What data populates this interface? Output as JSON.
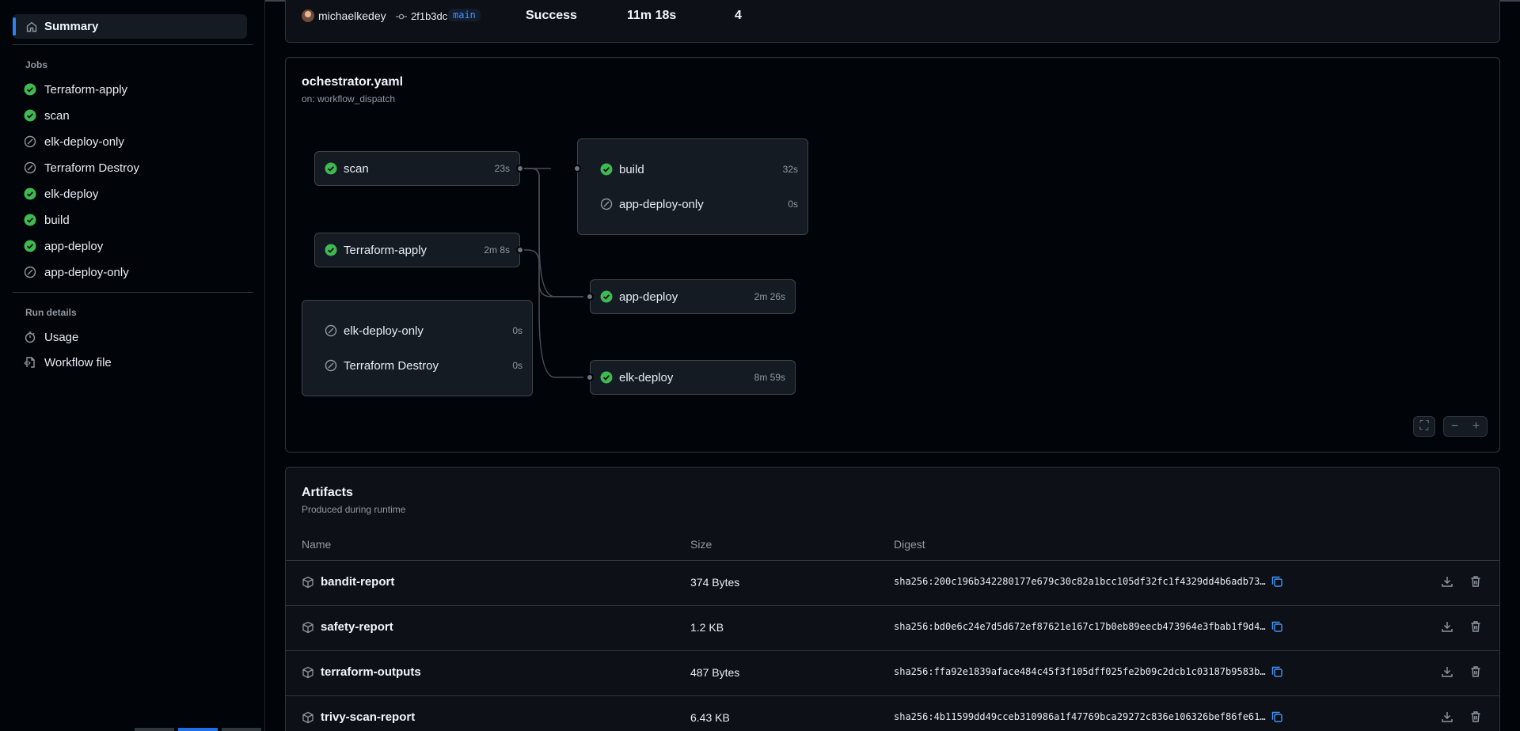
{
  "sidebar": {
    "summary_label": "Summary",
    "jobs_heading": "Jobs",
    "jobs": [
      {
        "label": "Terraform-apply",
        "status": "success"
      },
      {
        "label": "scan",
        "status": "success"
      },
      {
        "label": "elk-deploy-only",
        "status": "skipped"
      },
      {
        "label": "Terraform Destroy",
        "status": "skipped"
      },
      {
        "label": "elk-deploy",
        "status": "success"
      },
      {
        "label": "build",
        "status": "success"
      },
      {
        "label": "app-deploy",
        "status": "success"
      },
      {
        "label": "app-deploy-only",
        "status": "skipped"
      }
    ],
    "run_details_heading": "Run details",
    "run_details": [
      {
        "label": "Usage",
        "icon": "stopwatch-icon"
      },
      {
        "label": "Workflow file",
        "icon": "file-code-icon"
      }
    ]
  },
  "run_info": {
    "actor": "michaelkedey",
    "commit": "2f1b3dc",
    "branch": "main",
    "status": "Success",
    "duration": "11m 18s",
    "artifacts": "4"
  },
  "graph": {
    "title": "ochestrator.yaml",
    "trigger": "on: workflow_dispatch",
    "jobs": {
      "scan": {
        "label": "scan",
        "duration": "23s"
      },
      "terraform_apply": {
        "label": "Terraform-apply",
        "duration": "2m 8s"
      },
      "build": {
        "label": "build",
        "duration": "32s"
      },
      "app_deploy_only": {
        "label": "app-deploy-only",
        "duration": "0s"
      },
      "app_deploy": {
        "label": "app-deploy",
        "duration": "2m 26s"
      },
      "elk_deploy": {
        "label": "elk-deploy",
        "duration": "8m 59s"
      },
      "elk_deploy_only": {
        "label": "elk-deploy-only",
        "duration": "0s"
      },
      "terraform_destroy": {
        "label": "Terraform Destroy",
        "duration": "0s"
      }
    },
    "controls": {
      "fullscreen": "⛶",
      "zoom_out": "−",
      "zoom_in": "+"
    }
  },
  "artifacts": {
    "title": "Artifacts",
    "subtitle": "Produced during runtime",
    "columns": {
      "name": "Name",
      "size": "Size",
      "digest": "Digest"
    },
    "rows": [
      {
        "name": "bandit-report",
        "size": "374 Bytes",
        "digest": "sha256:200c196b342280177e679c30c82a1bcc105df32fc1f4329dd4b6adb73…"
      },
      {
        "name": "safety-report",
        "size": "1.2 KB",
        "digest": "sha256:bd0e6c24e7d5d672ef87621e167c17b0eb89eecb473964e3fbab1f9d4…"
      },
      {
        "name": "terraform-outputs",
        "size": "487 Bytes",
        "digest": "sha256:ffa92e1839aface484c45f3f105dff025fe2b09c2dcb1c03187b9583b…"
      },
      {
        "name": "trivy-scan-report",
        "size": "6.43 KB",
        "digest": "sha256:4b11599dd49cceb310986a1f47769bca29272c836e106326bef86fe61…"
      }
    ]
  },
  "colors": {
    "success": "#3fb950",
    "skipped": "#9198a1",
    "accent": "#2f81f7"
  }
}
